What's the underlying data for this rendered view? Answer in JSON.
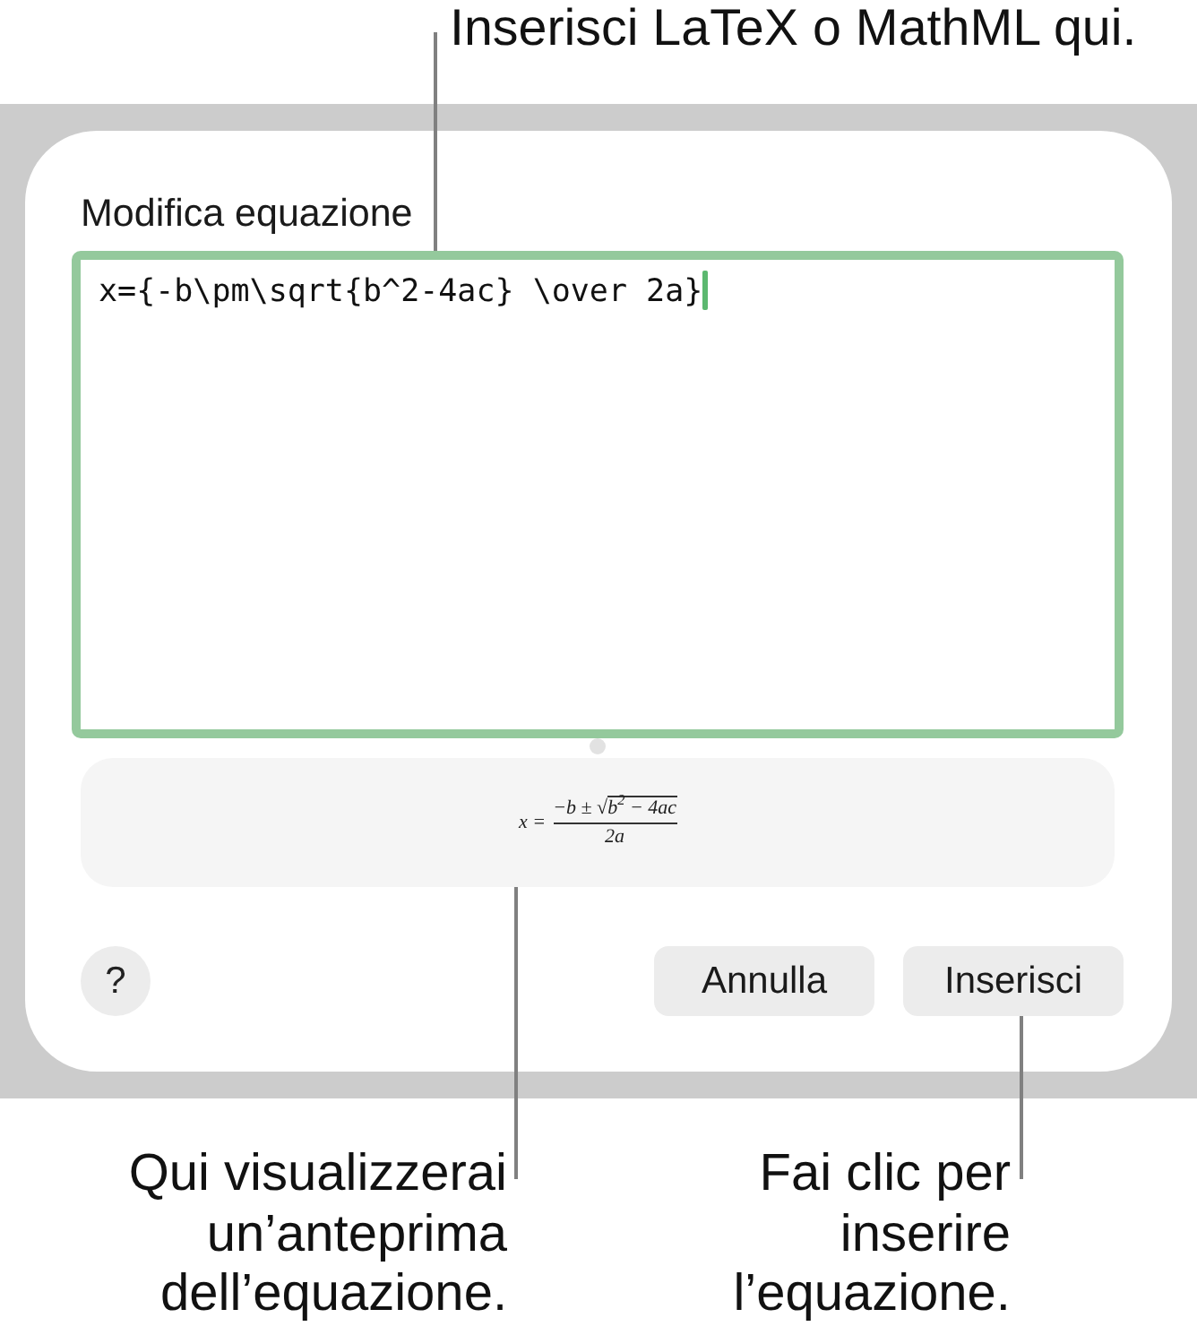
{
  "top_callout": {
    "text": "Inserisci LaTeX o MathML qui."
  },
  "dialog": {
    "field_label": "Modifica equazione",
    "equation_input": {
      "value": "x={-b\\pm\\sqrt{b^2-4ac} \\over 2a}",
      "focused": true
    },
    "preview": {
      "lhs": "x =",
      "numerator": "−b ±",
      "radical_sign": "√",
      "radicand": "b$^{2}$ − 4ac",
      "denominator": "2a"
    },
    "help_button": {
      "label": "?"
    },
    "buttons": [
      {
        "label": "Annulla"
      },
      {
        "label": "Inserisci"
      }
    ]
  },
  "bottom_callouts": [
    {
      "lines": [
        "Qui visualizzerai",
        "un’anteprima",
        "dell’equazione."
      ]
    },
    {
      "lines": [
        "Fai clic per",
        "inserire",
        "l’equazione."
      ]
    }
  ]
}
